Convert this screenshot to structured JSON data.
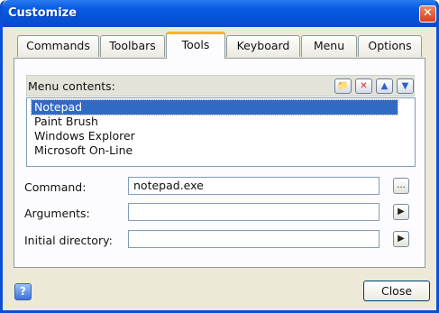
{
  "window": {
    "title": "Customize",
    "close_glyph": "✕"
  },
  "tabs": [
    {
      "label": "Commands"
    },
    {
      "label": "Toolbars"
    },
    {
      "label": "Tools",
      "active": true
    },
    {
      "label": "Keyboard"
    },
    {
      "label": "Menu"
    },
    {
      "label": "Options"
    }
  ],
  "menu_contents": {
    "label": "Menu contents:",
    "buttons": [
      {
        "icon": "new-folder-icon",
        "glyph": "📁"
      },
      {
        "icon": "delete-icon",
        "glyph": "✕"
      },
      {
        "icon": "move-up-icon",
        "glyph": "▲"
      },
      {
        "icon": "move-down-icon",
        "glyph": "▼"
      }
    ],
    "items": [
      "Notepad",
      "Paint Brush",
      "Windows Explorer",
      "Microsoft On-Line"
    ],
    "selected": "Notepad"
  },
  "form": {
    "command_label": "Command:",
    "command_value": "notepad.exe",
    "browse_glyph": "...",
    "arguments_label": "Arguments:",
    "arguments_value": "",
    "initial_dir_label": "Initial directory:",
    "initial_dir_value": "",
    "arrow_glyph": "▶"
  },
  "footer": {
    "help_glyph": "?",
    "close_label": "Close"
  },
  "colors": {
    "titlebar": "#0451d7",
    "selection": "#316ac5",
    "active_tab_accent": "#f1b530"
  }
}
